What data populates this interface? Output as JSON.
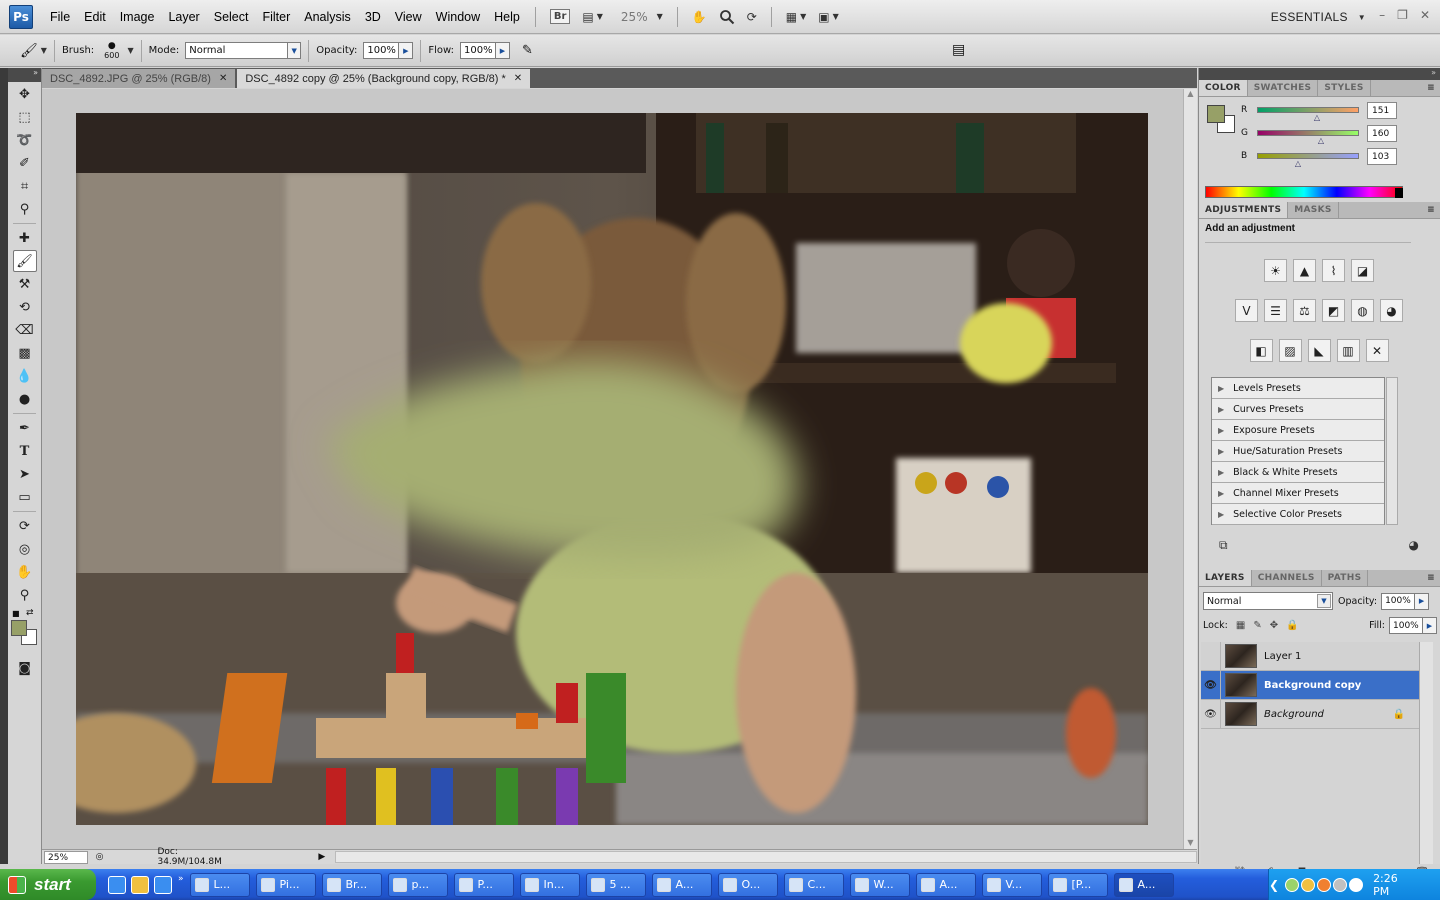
{
  "menubar": {
    "logo": "Ps",
    "items": [
      "File",
      "Edit",
      "Image",
      "Layer",
      "Select",
      "Filter",
      "Analysis",
      "3D",
      "View",
      "Window",
      "Help"
    ],
    "bridge_label": "Br",
    "zoom_value": "25%",
    "workspace": "ESSENTIALS"
  },
  "options": {
    "brush_label": "Brush:",
    "brush_size": "600",
    "mode_label": "Mode:",
    "mode_value": "Normal",
    "opacity_label": "Opacity:",
    "opacity_value": "100%",
    "flow_label": "Flow:",
    "flow_value": "100%"
  },
  "tabs": [
    {
      "label": "DSC_4892.JPG @ 25% (RGB/8)"
    },
    {
      "label": "DSC_4892 copy @ 25% (Background copy, RGB/8) *"
    }
  ],
  "status": {
    "zoom": "25%",
    "doc": "Doc: 34.9M/104.8M"
  },
  "color_panel": {
    "tabs": [
      "COLOR",
      "SWATCHES",
      "STYLES"
    ],
    "foreground": "#97a067",
    "channels": [
      {
        "label": "R",
        "value": "151",
        "fraction": 0.59
      },
      {
        "label": "G",
        "value": "160",
        "fraction": 0.63
      },
      {
        "label": "B",
        "value": "103",
        "fraction": 0.4
      }
    ]
  },
  "adjustments": {
    "tabs": [
      "ADJUSTMENTS",
      "MASKS"
    ],
    "title": "Add an adjustment",
    "presets": [
      "Levels Presets",
      "Curves Presets",
      "Exposure Presets",
      "Hue/Saturation Presets",
      "Black & White Presets",
      "Channel Mixer Presets",
      "Selective Color Presets"
    ]
  },
  "layers": {
    "tabs": [
      "LAYERS",
      "CHANNELS",
      "PATHS"
    ],
    "blend_mode": "Normal",
    "opacity_label": "Opacity:",
    "opacity_value": "100%",
    "lock_label": "Lock:",
    "fill_label": "Fill:",
    "fill_value": "100%",
    "items": [
      {
        "name": "Layer 1",
        "visible": false
      },
      {
        "name": "Background copy",
        "visible": true,
        "selected": true
      },
      {
        "name": "Background",
        "visible": true,
        "locked": true
      }
    ]
  },
  "taskbar": {
    "start": "start",
    "buttons": [
      "L...",
      "Pi...",
      "Br...",
      "p...",
      "P...",
      "In...",
      "5 ...",
      "A...",
      "O...",
      "C...",
      "W...",
      "A...",
      "V...",
      "[P...",
      "A...",
      "A..."
    ],
    "clock": "2:26 PM"
  }
}
